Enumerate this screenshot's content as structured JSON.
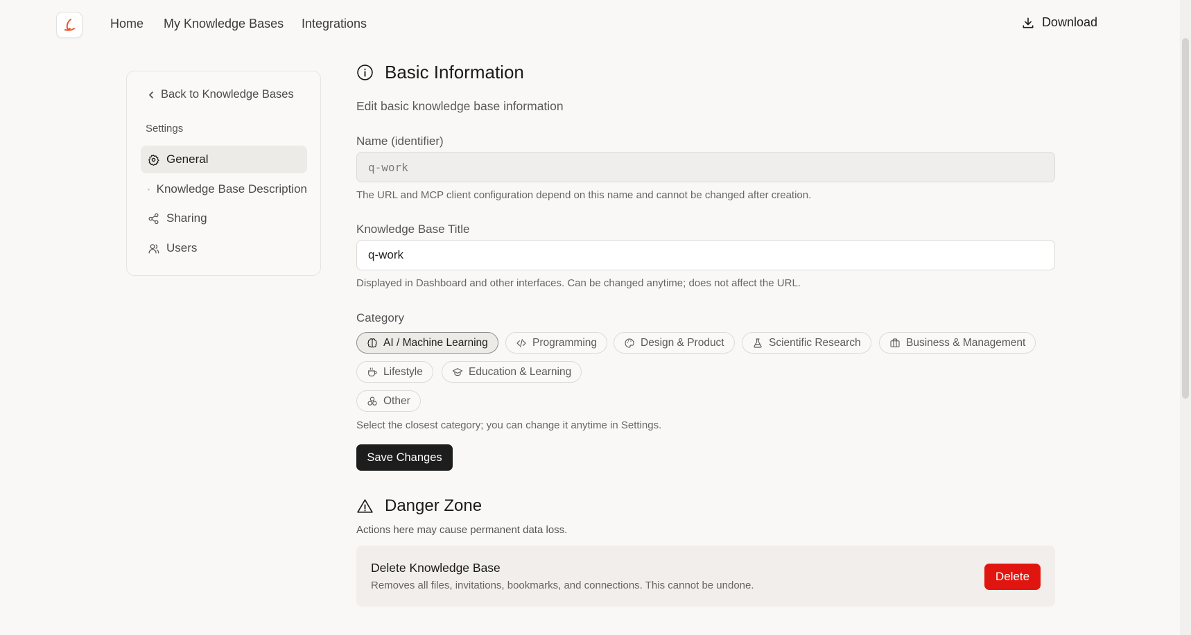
{
  "nav": {
    "links": [
      "Home",
      "My Knowledge Bases",
      "Integrations"
    ],
    "download_label": "Download"
  },
  "sidebar": {
    "back_label": "Back to Knowledge Bases",
    "section_label": "Settings",
    "items": [
      {
        "label": "General",
        "icon": "gear-icon",
        "active": true
      },
      {
        "label": "Knowledge Base Description",
        "icon": "book-icon",
        "active": false
      },
      {
        "label": "Sharing",
        "icon": "share-icon",
        "active": false
      },
      {
        "label": "Users",
        "icon": "user-icon",
        "active": false
      }
    ]
  },
  "basic": {
    "title": "Basic Information",
    "subtitle": "Edit basic knowledge base information",
    "name_label": "Name (identifier)",
    "name_value": "q-work",
    "name_help": "The URL and MCP client configuration depend on this name and cannot be changed after creation.",
    "title_label": "Knowledge Base Title",
    "title_value": "q-work",
    "title_help": "Displayed in Dashboard and other interfaces. Can be changed anytime; does not affect the URL.",
    "category_label": "Category",
    "categories": [
      {
        "label": "AI / Machine Learning",
        "icon": "brain-icon",
        "selected": true
      },
      {
        "label": "Programming",
        "icon": "code-icon",
        "selected": false
      },
      {
        "label": "Design & Product",
        "icon": "palette-icon",
        "selected": false
      },
      {
        "label": "Scientific Research",
        "icon": "flask-icon",
        "selected": false
      },
      {
        "label": "Business & Management",
        "icon": "briefcase-icon",
        "selected": false
      },
      {
        "label": "Lifestyle",
        "icon": "coffee-icon",
        "selected": false
      },
      {
        "label": "Education & Learning",
        "icon": "graduation-cap-icon",
        "selected": false
      },
      {
        "label": "Other",
        "icon": "shapes-icon",
        "selected": false
      }
    ],
    "category_help": "Select the closest category; you can change it anytime in Settings.",
    "save_label": "Save Changes"
  },
  "danger": {
    "title": "Danger Zone",
    "subtitle": "Actions here may cause permanent data loss.",
    "card_title": "Delete Knowledge Base",
    "card_desc": "Removes all files, invitations, bookmarks, and connections. This cannot be undone.",
    "delete_label": "Delete"
  },
  "colors": {
    "accent_logo": "#e8552b",
    "danger": "#e1150f",
    "primary_button": "#1d1d1d"
  }
}
